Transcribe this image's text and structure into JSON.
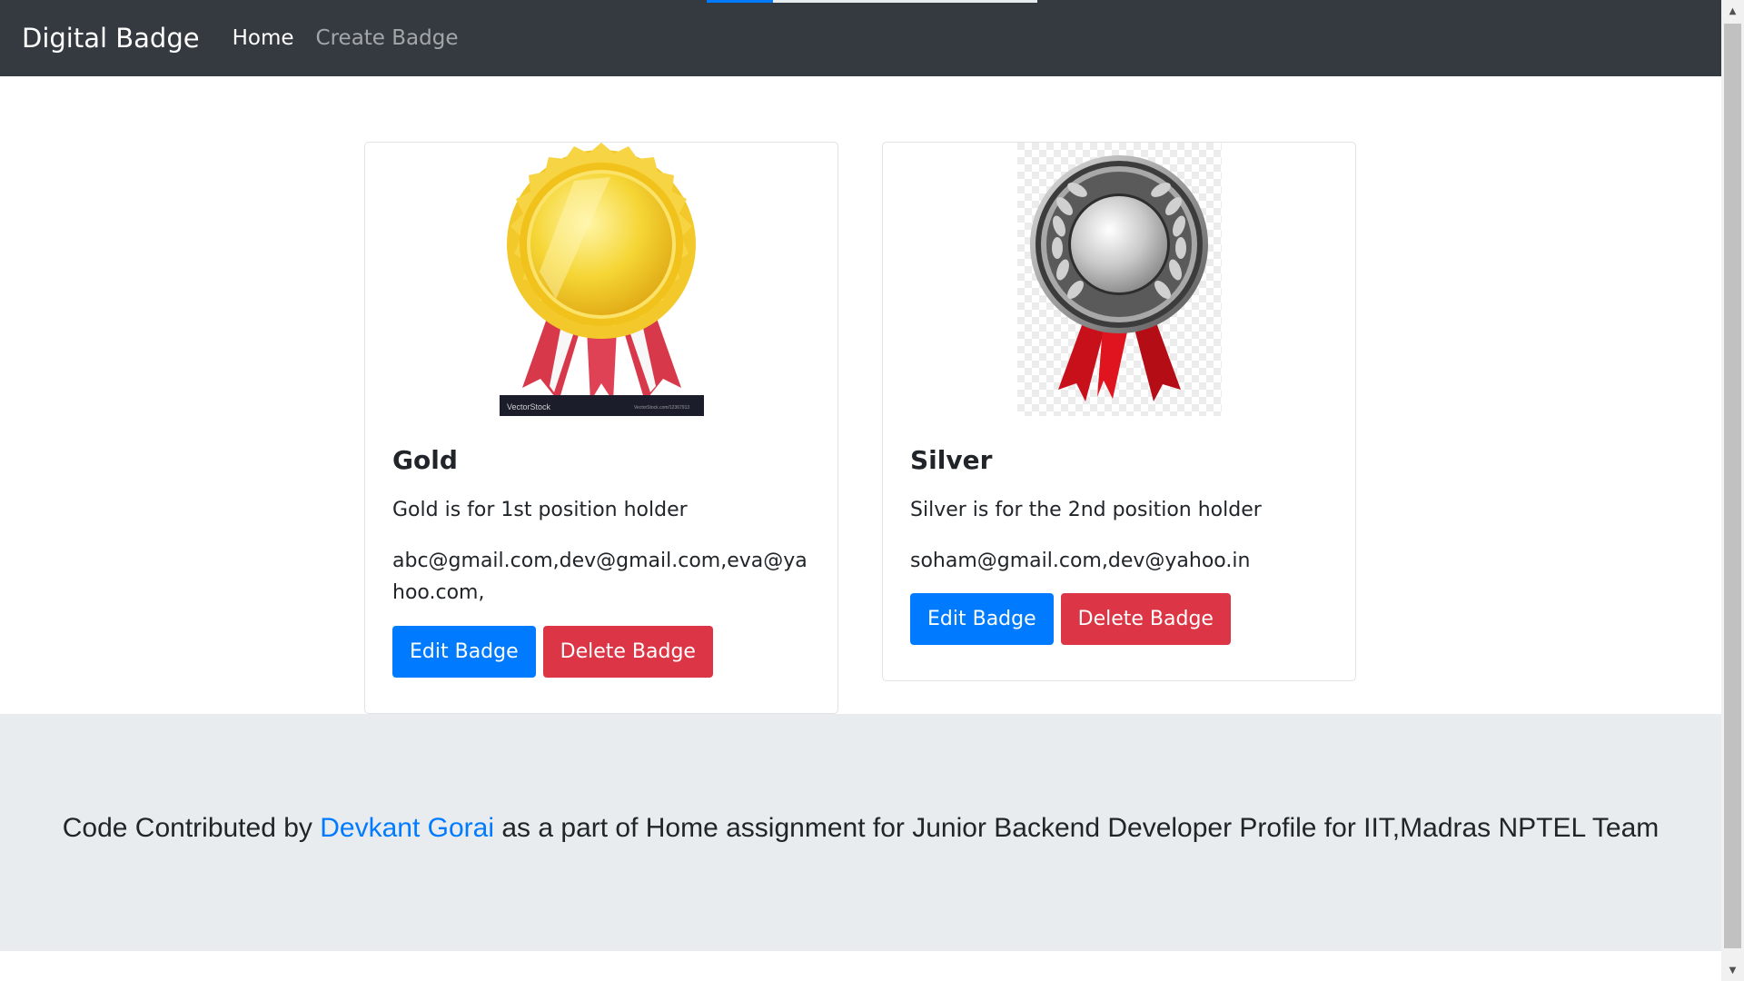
{
  "navbar": {
    "brand": "Digital Badge",
    "links": [
      {
        "label": "Home"
      },
      {
        "label": "Create Badge"
      }
    ]
  },
  "badges": [
    {
      "title": "Gold",
      "description": "Gold is for 1st position holder",
      "emails": "abc@gmail.com,dev@gmail.com,eva@yahoo.com,",
      "image_credit_left": "VectorStock",
      "image_credit_right": "VectorStock.com/12367913",
      "edit_label": "Edit Badge",
      "delete_label": "Delete Badge"
    },
    {
      "title": "Silver",
      "description": "Silver is for the 2nd position holder",
      "emails": "soham@gmail.com,dev@yahoo.in",
      "edit_label": "Edit Badge",
      "delete_label": "Delete Badge"
    }
  ],
  "footer": {
    "prefix": "Code Contributed by",
    "author": "Devkant Gorai",
    "suffix": "as a part of Home assignment for Junior Backend Developer Profile for IIT,Madras NPTEL Team"
  },
  "colors": {
    "navbar_bg": "#343a40",
    "primary": "#007bff",
    "danger": "#dc3545",
    "footer_bg": "#e9ecef"
  }
}
